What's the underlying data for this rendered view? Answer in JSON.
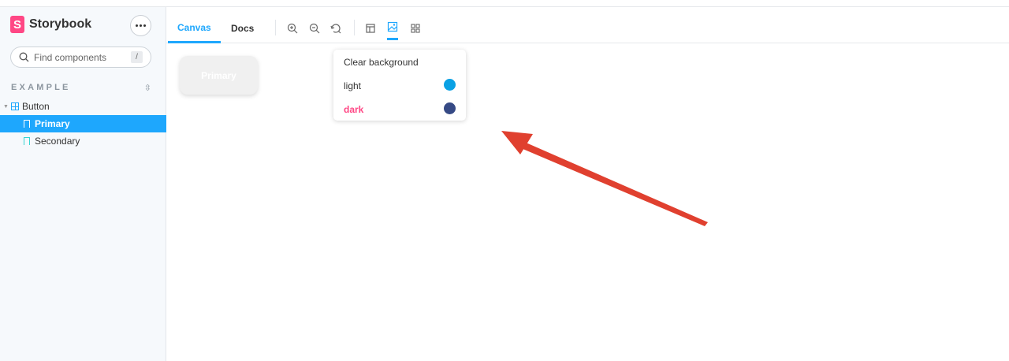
{
  "brand": {
    "logo_letter": "S",
    "name": "Storybook"
  },
  "search": {
    "placeholder": "Find components",
    "shortcut": "/"
  },
  "sidebar": {
    "section": "EXAMPLE",
    "component": "Button",
    "stories": [
      {
        "label": "Primary",
        "selected": true
      },
      {
        "label": "Secondary",
        "selected": false
      }
    ]
  },
  "toolbar": {
    "tabs": [
      {
        "label": "Canvas",
        "active": true
      },
      {
        "label": "Docs",
        "active": false
      }
    ]
  },
  "canvas": {
    "button_label": "Primary"
  },
  "backgrounds_menu": {
    "clear_label": "Clear background",
    "options": [
      {
        "label": "light",
        "color": "#0aa1e4"
      },
      {
        "label": "dark",
        "color": "#364a85"
      }
    ]
  },
  "colors": {
    "accent": "#1ea7fd",
    "brand": "#ff4785",
    "annotation_arrow": "#e0402f"
  }
}
